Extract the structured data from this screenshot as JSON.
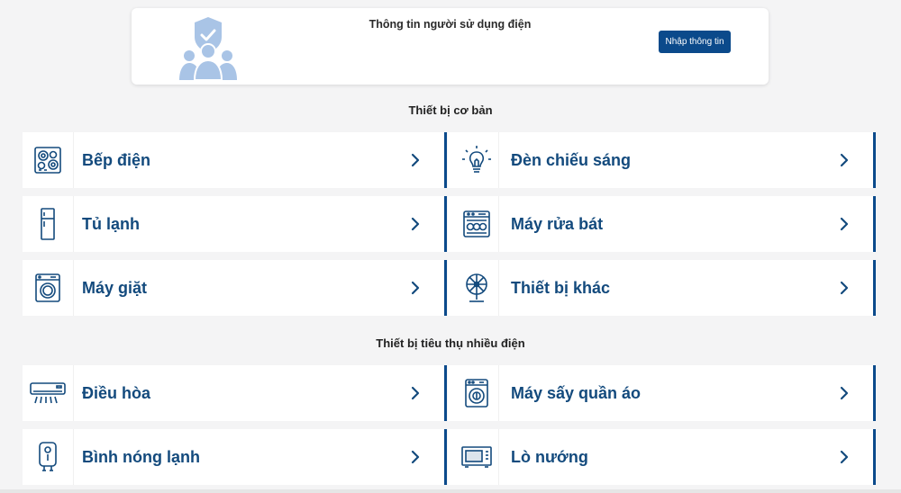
{
  "user_info": {
    "title": "Thông tin người sử dụng điện",
    "button": "Nhập thông tin"
  },
  "sections": {
    "basic_title": "Thiết bị cơ bản",
    "heavy_title": "Thiết bị tiêu thụ nhiều điện"
  },
  "basic_devices": [
    {
      "label": "Bếp điện",
      "icon": "electric-stove-icon"
    },
    {
      "label": "Đèn chiếu sáng",
      "icon": "light-bulb-icon"
    },
    {
      "label": "Tủ lạnh",
      "icon": "refrigerator-icon"
    },
    {
      "label": "Máy rửa bát",
      "icon": "dishwasher-icon"
    },
    {
      "label": "Máy giặt",
      "icon": "washing-machine-icon"
    },
    {
      "label": "Thiết bị khác",
      "icon": "fan-icon"
    }
  ],
  "heavy_devices": [
    {
      "label": "Điều hòa",
      "icon": "air-conditioner-icon"
    },
    {
      "label": "Máy sấy quần áo",
      "icon": "clothes-dryer-icon"
    },
    {
      "label": "Bình nóng lạnh",
      "icon": "water-heater-icon"
    },
    {
      "label": "Lò nướng",
      "icon": "oven-icon"
    }
  ],
  "colors": {
    "brand": "#0b4a8b",
    "label": "#134a7d",
    "illustration": "#a9c4e6",
    "background": "#f4f4f5"
  }
}
